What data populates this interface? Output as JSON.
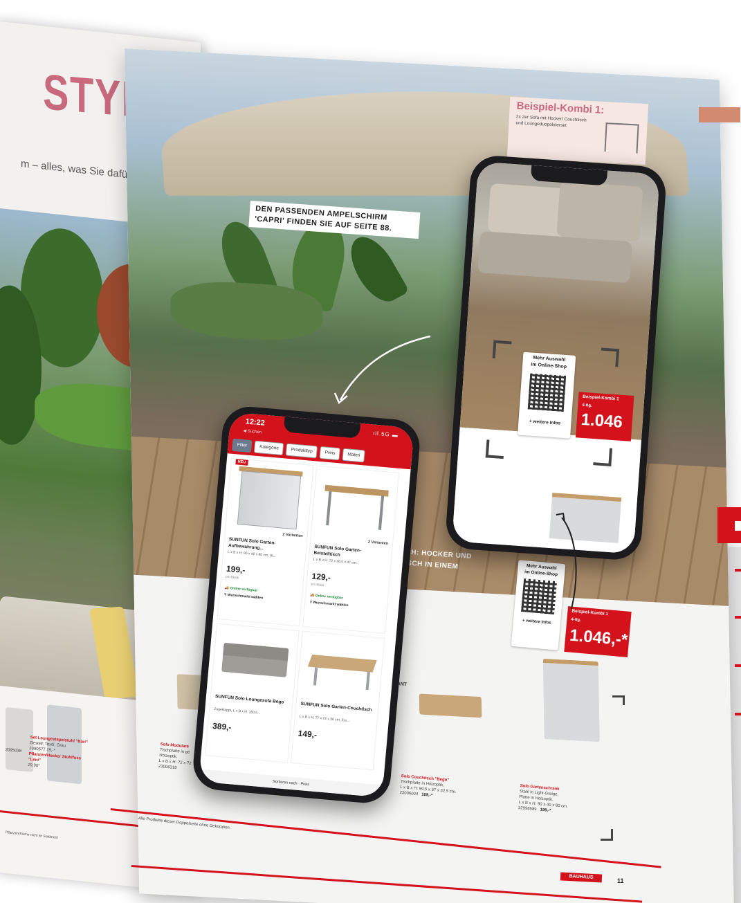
{
  "magazine": {
    "left_title": "STYLE",
    "left_subline": "m – alles, was Sie dafür",
    "ampelschirm_note": "DEN PASSENDEN AMPELSCHIRM 'CAPRI' FINDEN SIE AUF SEITE 88.",
    "kombi": {
      "title": "Beispiel-Kombi 1:",
      "text": "2x 2er Sofa mit Hocker/ Couchtisch und Loungeduopolsterset"
    },
    "hocker_text": "SCH: HOCKER UND\nTISCH IN EINEM",
    "bottom_note": "Alle Produkte dieser Doppelseite ohne Dekoration.",
    "left_bottom_note": "Pflanzen/Küche nicht im Sortiment",
    "page_number": "11",
    "brand": "BAUHAUS",
    "variant_label": "ANT",
    "left_captions": [
      {
        "title": "Set Loungestapelstuhl \"Bari\"",
        "line": "Gestell: Textil, Grau",
        "code": "2080577",
        "price": "19,-*"
      },
      {
        "title": "Pflanzen/Hocker Stuhlfuss \"Leni\"",
        "line": "",
        "code": "2095038",
        "price": "29,90*"
      }
    ],
    "right_captions": [
      {
        "title": "Solo Couchtisch \"Bego\"",
        "line1": "Tischplatte in Holzoptik,",
        "line2": "L x B x H: 99,5 x 57 x 32,5 cm.",
        "code": "23006004",
        "price": "109,-*"
      },
      {
        "title": "Solo Gartenschrank",
        "line1": "Stahl in Light-Greige,",
        "line2": "Platte in Holzoptik,",
        "line3": "L x B x H: 90 x 40 x 80 cm.",
        "code": "32998589",
        "price": "199,-*"
      },
      {
        "title": "Solo Modulare",
        "line1": "Tischplatte in ge",
        "line2": "Holzoptik,",
        "line3": "L x B x H: 72 x 72",
        "code": "23006318",
        "price": ""
      }
    ],
    "qr_card": {
      "line1": "Mehr Auswahl",
      "line2": "im Online-Shop",
      "foot": "+ weitere Infos"
    },
    "price_tag": {
      "label": "Beispiel-Kombi 1",
      "sub": "4-tlg.",
      "price": "1.046,-*"
    }
  },
  "phone_left": {
    "time": "12:22",
    "back_label": "◀ Suchen",
    "status": "ıll 5G ▬",
    "filters": [
      "Filter",
      "Kategorie",
      "Produkttyp",
      "Preis",
      "Materi"
    ],
    "products": [
      {
        "badge": "NEU",
        "variants": "2 Varianten",
        "title": "SUNFUN Solo Garten-Aufbewahrung...",
        "desc": "L x B x H: 90 x 40 x 80 cm, St...",
        "price": "199,-",
        "note": "pro Stück",
        "avail": "Online verfügbar",
        "market": "Wunschmarkt wählen"
      },
      {
        "badge": "",
        "variants": "2 Varianten",
        "title": "SUNFUN Solo Garten-Beistelltisch",
        "desc": "L x B x H: 72 x 30,5 x 47 cm...",
        "price": "129,-",
        "note": "pro Stück",
        "avail": "Online verfügbar",
        "market": "Wunschmarkt wählen"
      },
      {
        "badge": "",
        "variants": "",
        "title": "SUNFUN Solo Loungesofa Bego",
        "desc": "Zugeklappt, L x B x H: 160,5...",
        "price": "389,-",
        "note": "",
        "avail": "",
        "market": ""
      },
      {
        "badge": "",
        "variants": "",
        "title": "SUNFUN Solo Garten-Couchtisch",
        "desc": "L x B x H: 77 x 72 x 36 cm, Em...",
        "price": "149,-",
        "note": "",
        "avail": "",
        "market": ""
      }
    ],
    "bottom_bar": "Sortieren nach  ·  Preis"
  },
  "phone_right": {
    "qr_card": {
      "line1": "Mehr Auswahl",
      "line2": "im Online-Shop",
      "foot": "+ weitere Infos"
    },
    "price_tag": {
      "label": "Beispiel-Kombi 1",
      "sub": "4-tlg.",
      "price": "1.046"
    }
  },
  "colors": {
    "brand_red": "#d3121b",
    "style_pink": "#c8697e"
  }
}
